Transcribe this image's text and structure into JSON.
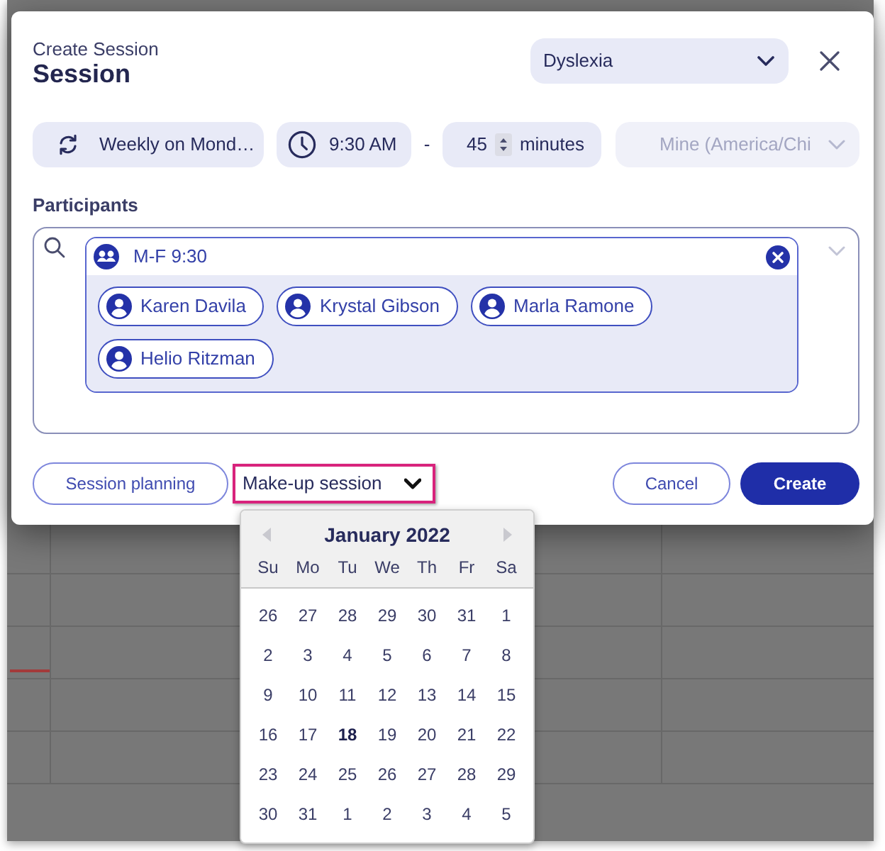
{
  "dialog": {
    "subtitle": "Create Session",
    "title": "Session",
    "category": {
      "value": "Dyslexia"
    }
  },
  "schedule": {
    "recurrence": "Weekly on Mond…",
    "start_time": "9:30 AM",
    "separator": "-",
    "duration": "45",
    "duration_unit": "minutes",
    "timezone": {
      "value": "Mine (America/Chi",
      "disabled": true
    }
  },
  "participants": {
    "label": "Participants",
    "groups": [
      {
        "name": "M-F 9:30",
        "members": [
          {
            "name": "Karen Davila"
          },
          {
            "name": "Krystal Gibson"
          },
          {
            "name": "Marla Ramone"
          },
          {
            "name": "Helio Ritzman"
          }
        ]
      }
    ]
  },
  "footer": {
    "session_planning": "Session planning",
    "session_type": {
      "value": "Make-up session",
      "highlighted": true
    },
    "cancel": "Cancel",
    "create": "Create"
  },
  "date_picker": {
    "month": "January 2022",
    "weekdays": [
      "Su",
      "Mo",
      "Tu",
      "We",
      "Th",
      "Fr",
      "Sa"
    ],
    "weeks": [
      [
        {
          "day": "26",
          "selected": false
        },
        {
          "day": "27",
          "selected": false
        },
        {
          "day": "28",
          "selected": false
        },
        {
          "day": "29",
          "selected": false
        },
        {
          "day": "30",
          "selected": false
        },
        {
          "day": "31",
          "selected": false
        },
        {
          "day": "1",
          "selected": false
        }
      ],
      [
        {
          "day": "2",
          "selected": false
        },
        {
          "day": "3",
          "selected": false
        },
        {
          "day": "4",
          "selected": false
        },
        {
          "day": "5",
          "selected": false
        },
        {
          "day": "6",
          "selected": false
        },
        {
          "day": "7",
          "selected": false
        },
        {
          "day": "8",
          "selected": false
        }
      ],
      [
        {
          "day": "9",
          "selected": false
        },
        {
          "day": "10",
          "selected": false
        },
        {
          "day": "11",
          "selected": false
        },
        {
          "day": "12",
          "selected": false
        },
        {
          "day": "13",
          "selected": false
        },
        {
          "day": "14",
          "selected": false
        },
        {
          "day": "15",
          "selected": false
        }
      ],
      [
        {
          "day": "16",
          "selected": false
        },
        {
          "day": "17",
          "selected": false
        },
        {
          "day": "18",
          "selected": true
        },
        {
          "day": "19",
          "selected": false
        },
        {
          "day": "20",
          "selected": false
        },
        {
          "day": "21",
          "selected": false
        },
        {
          "day": "22",
          "selected": false
        }
      ],
      [
        {
          "day": "23",
          "selected": false
        },
        {
          "day": "24",
          "selected": false
        },
        {
          "day": "25",
          "selected": false
        },
        {
          "day": "26",
          "selected": false
        },
        {
          "day": "27",
          "selected": false
        },
        {
          "day": "28",
          "selected": false
        },
        {
          "day": "29",
          "selected": false
        }
      ],
      [
        {
          "day": "30",
          "selected": false
        },
        {
          "day": "31",
          "selected": false
        },
        {
          "day": "1",
          "selected": false
        },
        {
          "day": "2",
          "selected": false
        },
        {
          "day": "3",
          "selected": false
        },
        {
          "day": "4",
          "selected": false
        },
        {
          "day": "5",
          "selected": false
        }
      ]
    ]
  }
}
